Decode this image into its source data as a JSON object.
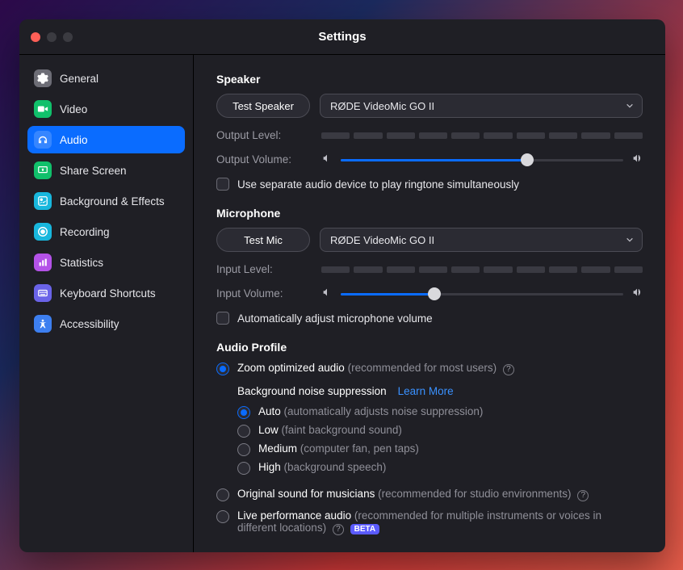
{
  "title": "Settings",
  "sidebar": {
    "items": [
      {
        "label": "General",
        "color": "#6d6d76"
      },
      {
        "label": "Video",
        "color": "#11c06b"
      },
      {
        "label": "Audio",
        "color": "#0a6cff",
        "selected": true
      },
      {
        "label": "Share Screen",
        "color": "#11c06b"
      },
      {
        "label": "Background & Effects",
        "color": "#18b7dd"
      },
      {
        "label": "Recording",
        "color": "#18b7dd"
      },
      {
        "label": "Statistics",
        "color": "#b452e8"
      },
      {
        "label": "Keyboard Shortcuts",
        "color": "#6a63e8"
      },
      {
        "label": "Accessibility",
        "color": "#3d7ff0"
      }
    ]
  },
  "speaker": {
    "heading": "Speaker",
    "test_btn": "Test Speaker",
    "device": "RØDE VideoMic GO II",
    "output_level_label": "Output Level:",
    "output_volume_label": "Output Volume:",
    "output_volume_pct": 66,
    "separate_device": "Use separate audio device to play ringtone simultaneously"
  },
  "mic": {
    "heading": "Microphone",
    "test_btn": "Test Mic",
    "device": "RØDE VideoMic GO II",
    "input_level_label": "Input Level:",
    "input_volume_label": "Input Volume:",
    "input_volume_pct": 33,
    "auto_adjust": "Automatically adjust microphone volume"
  },
  "profile": {
    "heading": "Audio Profile",
    "optimized": {
      "label": "Zoom optimized audio",
      "hint": "(recommended for most users)"
    },
    "bgns": {
      "heading": "Background noise suppression",
      "learn_more": "Learn More",
      "auto": {
        "label": "Auto",
        "hint": "(automatically adjusts noise suppression)"
      },
      "low": {
        "label": "Low",
        "hint": "(faint background sound)"
      },
      "medium": {
        "label": "Medium",
        "hint": "(computer fan, pen taps)"
      },
      "high": {
        "label": "High",
        "hint": "(background speech)"
      }
    },
    "original": {
      "label": "Original sound for musicians",
      "hint": "(recommended for studio environments)"
    },
    "live": {
      "label": "Live performance audio",
      "hint": "(recommended for multiple instruments or voices in different locations)",
      "beta": "BETA"
    }
  }
}
